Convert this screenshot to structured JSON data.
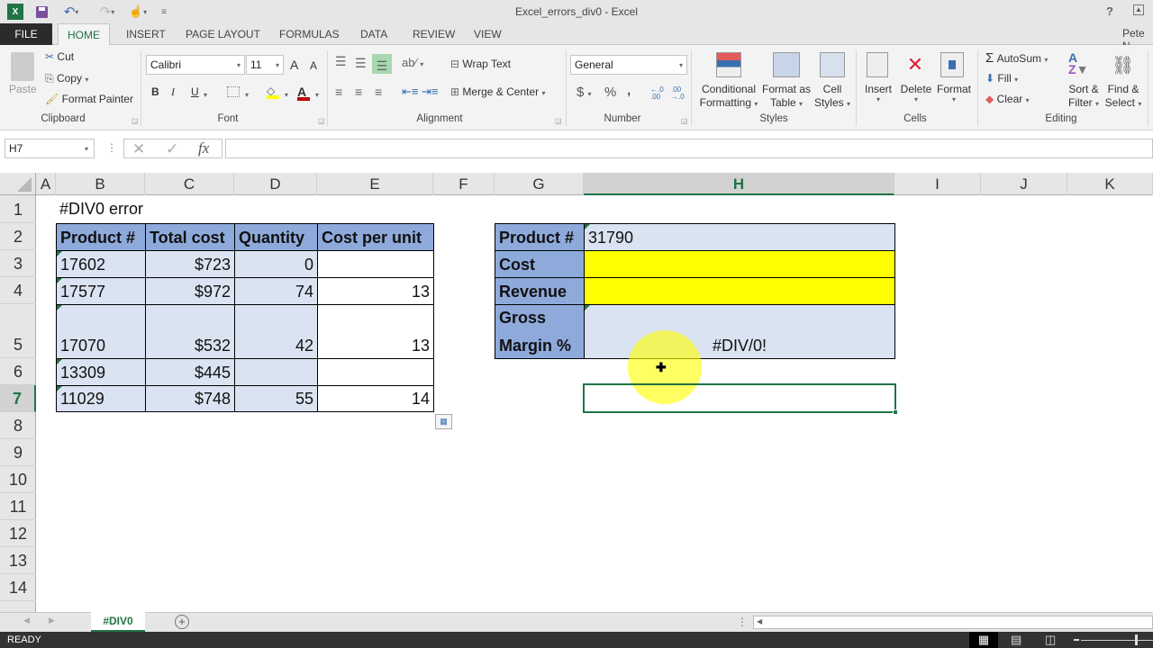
{
  "window": {
    "title": "Excel_errors_div0 - Excel",
    "help_label": "?",
    "user": "Pete N"
  },
  "quick_access": {
    "app_icon": "excel-icon",
    "save_icon": "save-icon",
    "undo_icon": "undo-icon",
    "redo_icon": "redo-icon",
    "touch_icon": "touch-mode-icon",
    "customize_icon": "customize-icon"
  },
  "tabs": [
    {
      "label": "FILE"
    },
    {
      "label": "HOME",
      "active": true
    },
    {
      "label": "INSERT"
    },
    {
      "label": "PAGE LAYOUT"
    },
    {
      "label": "FORMULAS"
    },
    {
      "label": "DATA"
    },
    {
      "label": "REVIEW"
    },
    {
      "label": "VIEW"
    }
  ],
  "ribbon": {
    "clipboard": {
      "label": "Clipboard",
      "paste": "Paste",
      "cut": "Cut",
      "copy": "Copy",
      "format_painter": "Format Painter"
    },
    "font": {
      "label": "Font",
      "font_name": "Calibri",
      "font_size": "11",
      "bold": "B",
      "italic": "I",
      "underline": "U",
      "grow": "A",
      "shrink": "A",
      "fill_color": "#ffff00",
      "font_color": "#c00000"
    },
    "alignment": {
      "label": "Alignment",
      "wrap_text": "Wrap Text",
      "merge_center": "Merge & Center"
    },
    "number": {
      "label": "Number",
      "format": "General",
      "currency": "$",
      "percent": "%",
      "comma": ",",
      "inc_decimal": "←.0 .00",
      "dec_decimal": ".00 →.0"
    },
    "styles": {
      "label": "Styles",
      "conditional_formatting": [
        "Conditional",
        "Formatting"
      ],
      "format_as_table": [
        "Format as",
        "Table"
      ],
      "cell_styles": [
        "Cell",
        "Styles"
      ]
    },
    "cells": {
      "label": "Cells",
      "insert": "Insert",
      "delete": "Delete",
      "format": "Format"
    },
    "editing": {
      "label": "Editing",
      "autosum": "AutoSum",
      "fill": "Fill",
      "clear": "Clear",
      "sort_filter": [
        "Sort &",
        "Filter"
      ],
      "find_select": [
        "Find &",
        "Select"
      ]
    }
  },
  "formula_bar": {
    "name_box": "H7",
    "cancel": "✕",
    "enter": "✓",
    "fx": "fx",
    "formula": ""
  },
  "grid": {
    "columns": [
      "A",
      "B",
      "C",
      "D",
      "E",
      "F",
      "G",
      "H",
      "I",
      "J",
      "K"
    ],
    "selected_column": "H",
    "rows": [
      "1",
      "2",
      "3",
      "4",
      "5",
      "6",
      "7",
      "8",
      "9",
      "10",
      "11",
      "12",
      "13",
      "14"
    ],
    "selected_row": "7",
    "title_cell": "#DIV0 error",
    "table1": {
      "headers": [
        "Product #",
        "Total cost",
        "Quantity",
        "Cost per unit"
      ],
      "rows": [
        [
          "17602",
          "$723",
          "0",
          ""
        ],
        [
          "17577",
          "$972",
          "74",
          "13"
        ],
        [
          "17070",
          "$532",
          "42",
          "13"
        ],
        [
          "13309",
          "$445",
          "",
          ""
        ],
        [
          "11029",
          "$748",
          "55",
          "14"
        ]
      ]
    },
    "table2": {
      "rows": [
        {
          "label": "Product #",
          "value": "31790"
        },
        {
          "label": "Cost",
          "value": ""
        },
        {
          "label": "Revenue",
          "value": ""
        },
        {
          "label_line1": "Gross",
          "label_line2": "Margin %",
          "value": "#DIV/0!"
        }
      ],
      "highlight_color": "#ffff00"
    },
    "active_cell": "H7"
  },
  "sheets": {
    "tabs": [
      {
        "label": "#DIV0",
        "active": true
      }
    ],
    "add_sheet": "+"
  },
  "status": {
    "mode": "READY"
  }
}
